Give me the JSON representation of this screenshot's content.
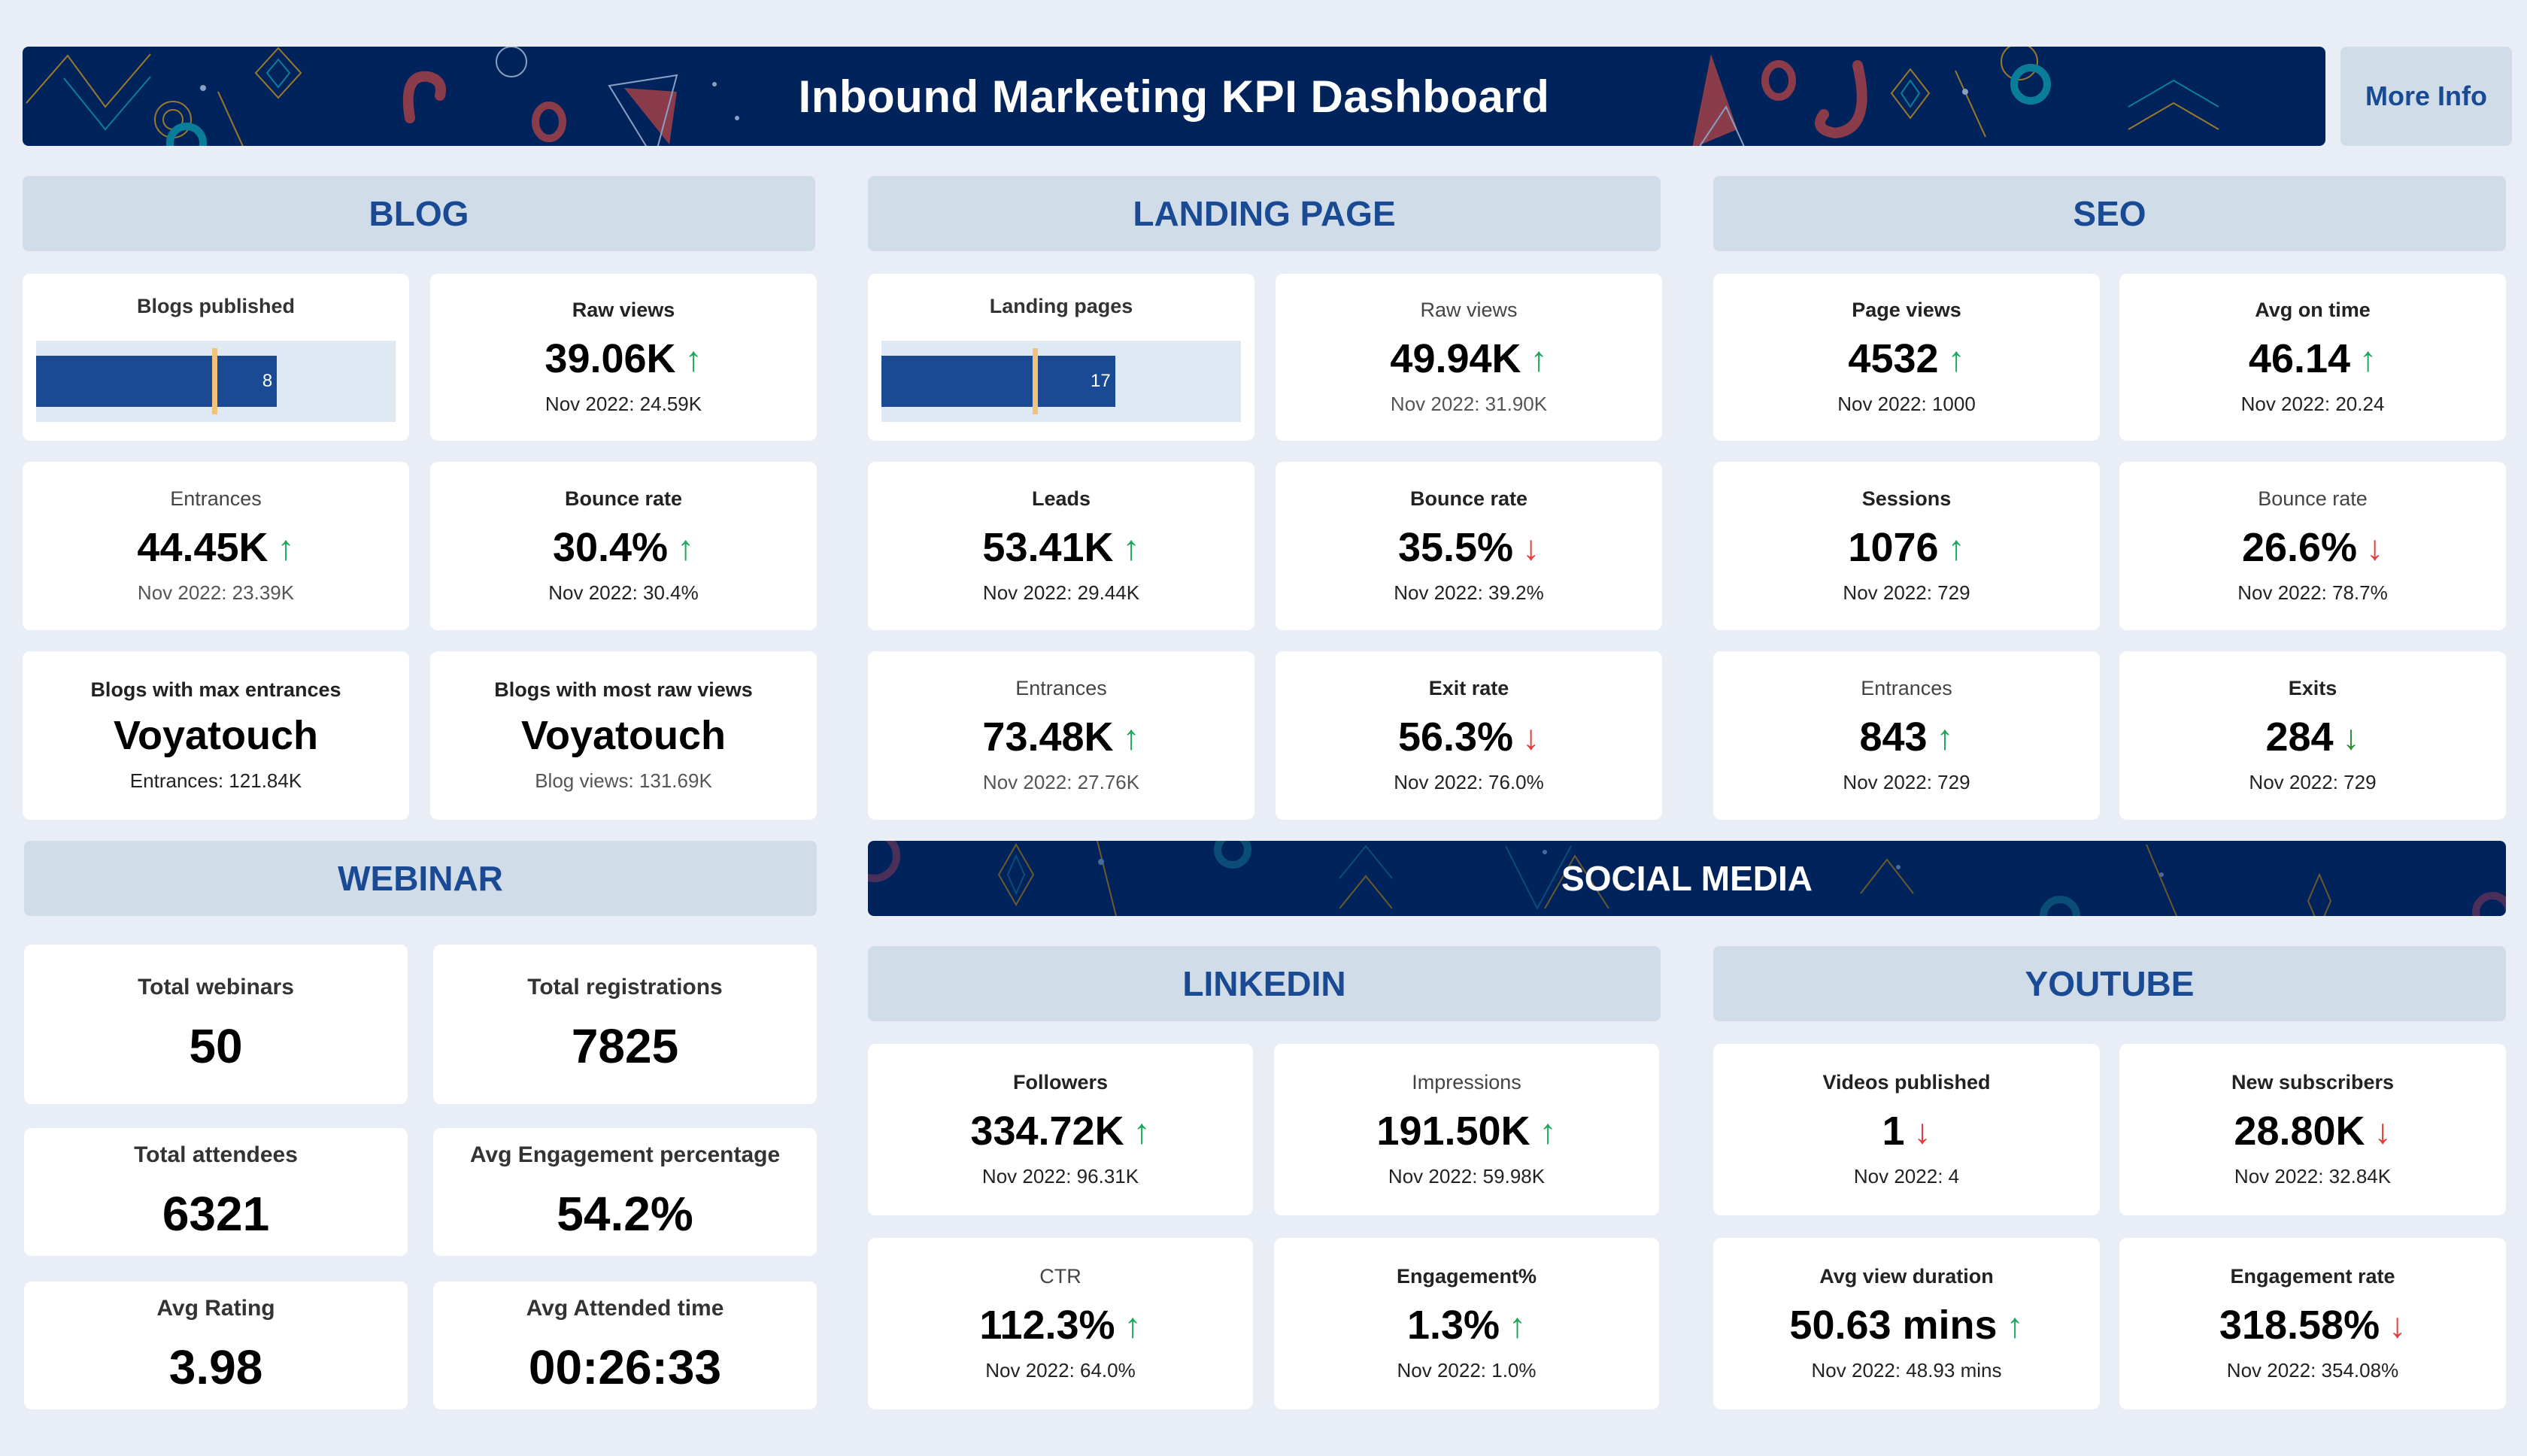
{
  "header": {
    "title": "Inbound Marketing KPI Dashboard",
    "more_info_label": "More Info"
  },
  "colors": {
    "banner_bg": "#00235c",
    "section_header_bg": "#d0dde9",
    "section_header_text": "#1a4a94",
    "page_bg": "#e9eef6",
    "bar_fill": "#1a4a94",
    "bar_track": "#dfe9f4",
    "target_marker": "#f1c27b",
    "trend_up": "#1aa75a",
    "trend_down": "#e53935"
  },
  "blog": {
    "title": "BLOG",
    "blogs_published": {
      "label": "Blogs published",
      "value": "8",
      "fill_fraction": 0.67,
      "target_fraction": 0.49
    },
    "raw_views": {
      "label": "Raw views",
      "value": "39.06K",
      "trend": "up",
      "compare": "Nov 2022: 24.59K"
    },
    "entrances": {
      "label": "Entrances",
      "value": "44.45K",
      "trend": "up",
      "compare": "Nov 2022: 23.39K"
    },
    "bounce_rate": {
      "label": "Bounce rate",
      "value": "30.4%",
      "trend": "up",
      "compare": "Nov 2022: 30.4%"
    },
    "max_entrances": {
      "label": "Blogs with max entrances",
      "value": "Voyatouch",
      "compare": "Entrances: 121.84K"
    },
    "most_raw_views": {
      "label": "Blogs with most raw views",
      "value": "Voyatouch",
      "compare": "Blog views: 131.69K"
    }
  },
  "landing_page": {
    "title": "LANDING PAGE",
    "landing_pages": {
      "label": "Landing pages",
      "value": "17",
      "fill_fraction": 0.65,
      "target_fraction": 0.42
    },
    "raw_views": {
      "label": "Raw views",
      "value": "49.94K",
      "trend": "up",
      "compare": "Nov 2022: 31.90K"
    },
    "leads": {
      "label": "Leads",
      "value": "53.41K",
      "trend": "up",
      "compare": "Nov 2022: 29.44K"
    },
    "bounce_rate": {
      "label": "Bounce rate",
      "value": "35.5%",
      "trend": "down",
      "compare": "Nov 2022: 39.2%"
    },
    "entrances": {
      "label": "Entrances",
      "value": "73.48K",
      "trend": "up",
      "compare": "Nov 2022: 27.76K"
    },
    "exit_rate": {
      "label": "Exit rate",
      "value": "56.3%",
      "trend": "down",
      "compare": "Nov 2022: 76.0%"
    }
  },
  "seo": {
    "title": "SEO",
    "page_views": {
      "label": "Page views",
      "value": "4532",
      "trend": "up",
      "compare": "Nov 2022: 1000"
    },
    "avg_on_time": {
      "label": "Avg on time",
      "value": "46.14",
      "trend": "up",
      "compare": "Nov 2022: 20.24"
    },
    "sessions": {
      "label": "Sessions",
      "value": "1076",
      "trend": "up",
      "compare": "Nov 2022: 729"
    },
    "bounce_rate": {
      "label": "Bounce rate",
      "value": "26.6%",
      "trend": "down",
      "compare": "Nov 2022: 78.7%"
    },
    "entrances": {
      "label": "Entrances",
      "value": "843",
      "trend": "up",
      "compare": "Nov 2022: 729"
    },
    "exits": {
      "label": "Exits",
      "value": "284",
      "trend": "down-good",
      "compare": "Nov 2022: 729"
    }
  },
  "webinar": {
    "title": "WEBINAR",
    "total_webinars": {
      "label": "Total webinars",
      "value": "50"
    },
    "total_registrations": {
      "label": "Total registrations",
      "value": "7825"
    },
    "total_attendees": {
      "label": "Total attendees",
      "value": "6321"
    },
    "avg_engagement": {
      "label": "Avg Engagement percentage",
      "value": "54.2%"
    },
    "avg_rating": {
      "label": "Avg Rating",
      "value": "3.98"
    },
    "avg_attended_time": {
      "label": "Avg Attended time",
      "value": "00:26:33"
    }
  },
  "social_media": {
    "title": "SOCIAL MEDIA",
    "linkedin": {
      "title": "LINKEDIN",
      "followers": {
        "label": "Followers",
        "value": "334.72K",
        "trend": "up",
        "compare": "Nov 2022: 96.31K"
      },
      "impressions": {
        "label": "Impressions",
        "value": "191.50K",
        "trend": "up",
        "compare": "Nov 2022: 59.98K"
      },
      "ctr": {
        "label": "CTR",
        "value": "112.3%",
        "trend": "up",
        "compare": "Nov 2022: 64.0%"
      },
      "engagement": {
        "label": "Engagement%",
        "value": "1.3%",
        "trend": "up",
        "compare": "Nov 2022: 1.0%"
      }
    },
    "youtube": {
      "title": "YOUTUBE",
      "videos_published": {
        "label": "Videos published",
        "value": "1",
        "trend": "down",
        "compare": "Nov 2022: 4"
      },
      "new_subscribers": {
        "label": "New subscribers",
        "value": "28.80K",
        "trend": "down",
        "compare": "Nov 2022: 32.84K"
      },
      "avg_view_duration": {
        "label": "Avg view duration",
        "value": "50.63 mins",
        "trend": "up",
        "compare": "Nov 2022: 48.93 mins"
      },
      "engagement_rate": {
        "label": "Engagement rate",
        "value": "318.58%",
        "trend": "down",
        "compare": "Nov 2022: 354.08%"
      }
    }
  },
  "icons": {
    "trend_up": "↑",
    "trend_down": "↓"
  }
}
